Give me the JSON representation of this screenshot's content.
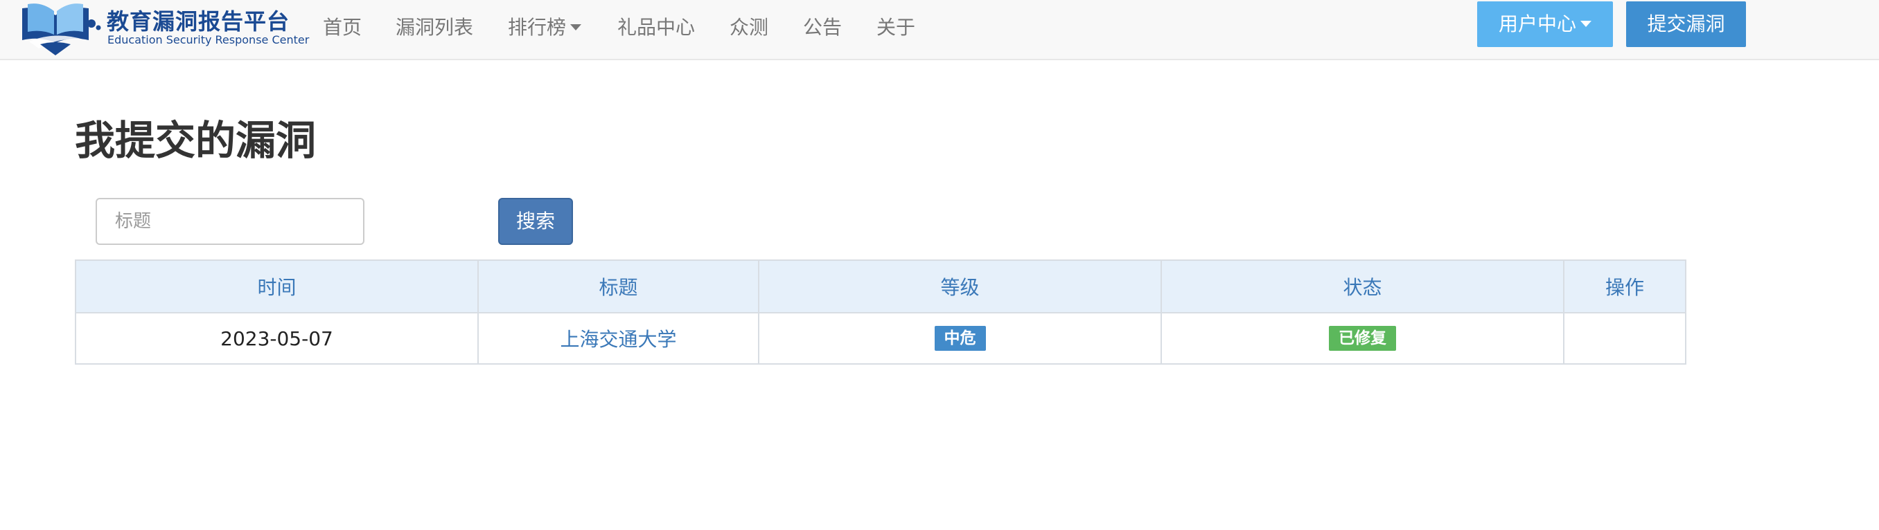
{
  "brand": {
    "name_cn": "教育漏洞报告平台",
    "name_en": "Education Security Response Center"
  },
  "nav": {
    "items": [
      {
        "label": "首页"
      },
      {
        "label": "漏洞列表"
      },
      {
        "label": "排行榜",
        "dropdown": true
      },
      {
        "label": "礼品中心"
      },
      {
        "label": "众测"
      },
      {
        "label": "公告"
      },
      {
        "label": "关于"
      }
    ],
    "user_center_label": "用户中心",
    "submit_label": "提交漏洞"
  },
  "page": {
    "title": "我提交的漏洞"
  },
  "search": {
    "placeholder": "标题",
    "value": "",
    "button_label": "搜索"
  },
  "table": {
    "headers": {
      "time": "时间",
      "title": "标题",
      "level": "等级",
      "status": "状态",
      "action": "操作"
    },
    "rows": [
      {
        "time": "2023-05-07",
        "title": "上海交通大学",
        "level": "中危",
        "status": "已修复",
        "action": ""
      }
    ]
  },
  "colors": {
    "brand": "#1b4a93",
    "user_center_bg": "#5bb4f0",
    "submit_bg": "#3f8fd1",
    "search_btn_bg": "#4a7ab5",
    "header_bg": "#e6f0fa",
    "header_text": "#3a78b8",
    "badge_level_bg": "#428bca",
    "badge_status_bg": "#5cb85c"
  },
  "icons": {
    "logo": "open-book-shield-logo",
    "dropdown": "caret-down-icon"
  }
}
